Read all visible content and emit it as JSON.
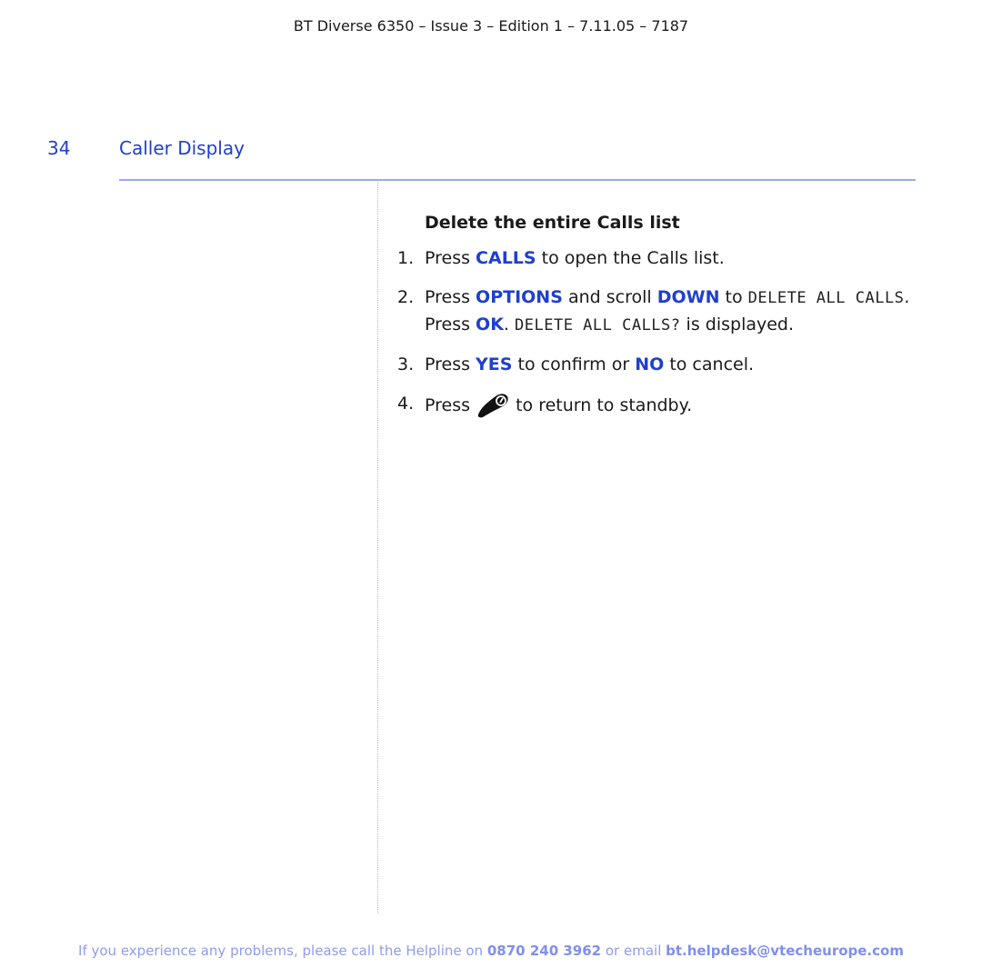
{
  "header": {
    "title": "BT Diverse 6350 – Issue 3 – Edition 1 – 7.11.05 – 7187"
  },
  "page": {
    "number": "34",
    "section": "Caller Display"
  },
  "content": {
    "subheading": "Delete the entire Calls list",
    "steps": [
      {
        "num": "1.",
        "parts": {
          "a": "Press ",
          "k1": "CALLS",
          "b": " to open the Calls list."
        }
      },
      {
        "num": "2.",
        "parts": {
          "a": "Press ",
          "k1": "OPTIONS",
          "b": " and scroll ",
          "k2": "DOWN",
          "c": " to ",
          "lcd1": "DELETE ALL CALLS",
          "d": ".",
          "e": "Press ",
          "k3": "OK",
          "f": ". ",
          "lcd2": "DELETE ALL CALLS?",
          "g": " is displayed."
        }
      },
      {
        "num": "3.",
        "parts": {
          "a": "Press ",
          "k1": "YES",
          "b": " to confirm or ",
          "k2": "NO",
          "c": " to cancel."
        }
      },
      {
        "num": "4.",
        "parts": {
          "a": "Press ",
          "icon": "end-call-icon",
          "b": " to return to standby."
        }
      }
    ]
  },
  "footer": {
    "text_a": "If you experience any problems, please call the Helpline on ",
    "phone": "0870 240 3962",
    "text_b": " or email ",
    "email": "bt.helpdesk@vtecheurope.com"
  },
  "colors": {
    "accent": "#1f3fd0",
    "rule": "#9aa9f0",
    "footer": "#8f9cf0"
  }
}
